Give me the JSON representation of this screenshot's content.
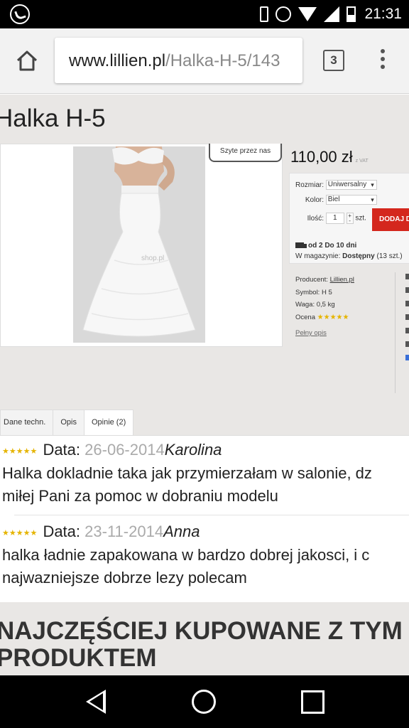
{
  "status_bar": {
    "time": "21:31",
    "icons": [
      "whatsapp-icon",
      "vibrate-icon",
      "alarm-icon",
      "wifi-icon",
      "signal-icon",
      "battery-icon"
    ]
  },
  "browser": {
    "url_host": "www.lillien.pl",
    "url_path": "/Halka-H-5/143",
    "tab_count": "3"
  },
  "product": {
    "title": "Halka H-5",
    "sewn_badge": "Szyte przez nas",
    "price": "110,00 zł",
    "price_note": "z VAT",
    "options": {
      "size_label": "Rozmiar:",
      "size_value": "Uniwersalny",
      "color_label": "Kolor:",
      "color_value": "Biel",
      "qty_label": "Ilość:",
      "qty_value": "1",
      "qty_unit": "szt.",
      "add_button": "DODAJ D",
      "delivery": "od 2 Do 10 dni",
      "stock_label": "W magazynie:",
      "stock_value": "Dostępny",
      "stock_count": "(13 szt.)"
    },
    "meta": {
      "producer_label": "Producent:",
      "producer_value": "Lillien.pl",
      "symbol_label": "Symbol:",
      "symbol_value": "H 5",
      "weight_label": "Waga:",
      "weight_value": "0,5 kg",
      "rating_label": "Ocena",
      "rating_stars": "★★★★★",
      "full_desc": "Pełny opis"
    }
  },
  "tabs": [
    {
      "label": "Dane techn."
    },
    {
      "label": "Opis"
    },
    {
      "label": "Opinie (2)"
    }
  ],
  "reviews": [
    {
      "stars": "★★★★★",
      "data_label": "Data:",
      "date": "26-06-2014",
      "author": "Karolina",
      "line1": "Halka dokladnie taka jak przymierzałam w salonie, dz",
      "line2": "miłej Pani za pomoc w dobraniu modelu"
    },
    {
      "stars": "★★★★★",
      "data_label": "Data:",
      "date": "23-11-2014",
      "author": "Anna",
      "line1": "halka ładnie zapakowana w bardzo dobrej jakosci, i c",
      "line2": "najwazniejsze dobrze lezy polecam"
    }
  ],
  "related": {
    "line1": "NAJCZĘŚCIEJ KUPOWANE Z TYM",
    "line2": "PRODUKTEM"
  },
  "colors": {
    "accent_red": "#d4271d",
    "star_gold": "#e5b400",
    "page_bg": "#e9e7e5"
  }
}
